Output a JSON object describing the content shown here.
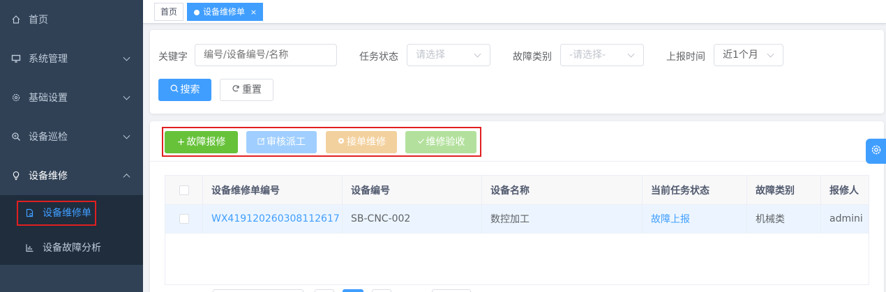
{
  "sidebar": {
    "items": [
      {
        "label": "首页",
        "icon": "home-icon"
      },
      {
        "label": "系统管理",
        "icon": "monitor-icon"
      },
      {
        "label": "基础设置",
        "icon": "gear-icon"
      },
      {
        "label": "设备巡检",
        "icon": "search-zoom-icon"
      },
      {
        "label": "设备维修",
        "icon": "lightbulb-icon"
      }
    ],
    "submenu": [
      {
        "label": "设备维修单",
        "icon": "document-icon"
      },
      {
        "label": "设备故障分析",
        "icon": "chart-icon"
      }
    ]
  },
  "tags": {
    "home": "首页",
    "current": "设备维修单",
    "close": "×"
  },
  "search": {
    "keyword_label": "关键字",
    "keyword_placeholder": "编号/设备编号/名称",
    "task_status_label": "任务状态",
    "task_status_value": "请选择",
    "fault_type_label": "故障类别",
    "fault_type_value": "-请选择-",
    "report_time_label": "上报时间",
    "report_time_value": "近1个月",
    "search_button": "搜索",
    "reset_button": "重置"
  },
  "toolbar": {
    "add": "故障报修",
    "audit": "审核派工",
    "accept": "接单维修",
    "check": "维修验收"
  },
  "table": {
    "columns": [
      "设备维修单编号",
      "设备编号",
      "设备名称",
      "当前任务状态",
      "故障类别",
      "报修人"
    ],
    "rows": [
      [
        "WX419120260308112617",
        "SB-CNC-002",
        "数控加工",
        "故障上报",
        "机械类",
        "admini"
      ]
    ]
  },
  "colors": {
    "sidebar_bg": "#304156",
    "primary": "#409eff",
    "success": "#67c23a",
    "highlight_border": "#e02020"
  }
}
